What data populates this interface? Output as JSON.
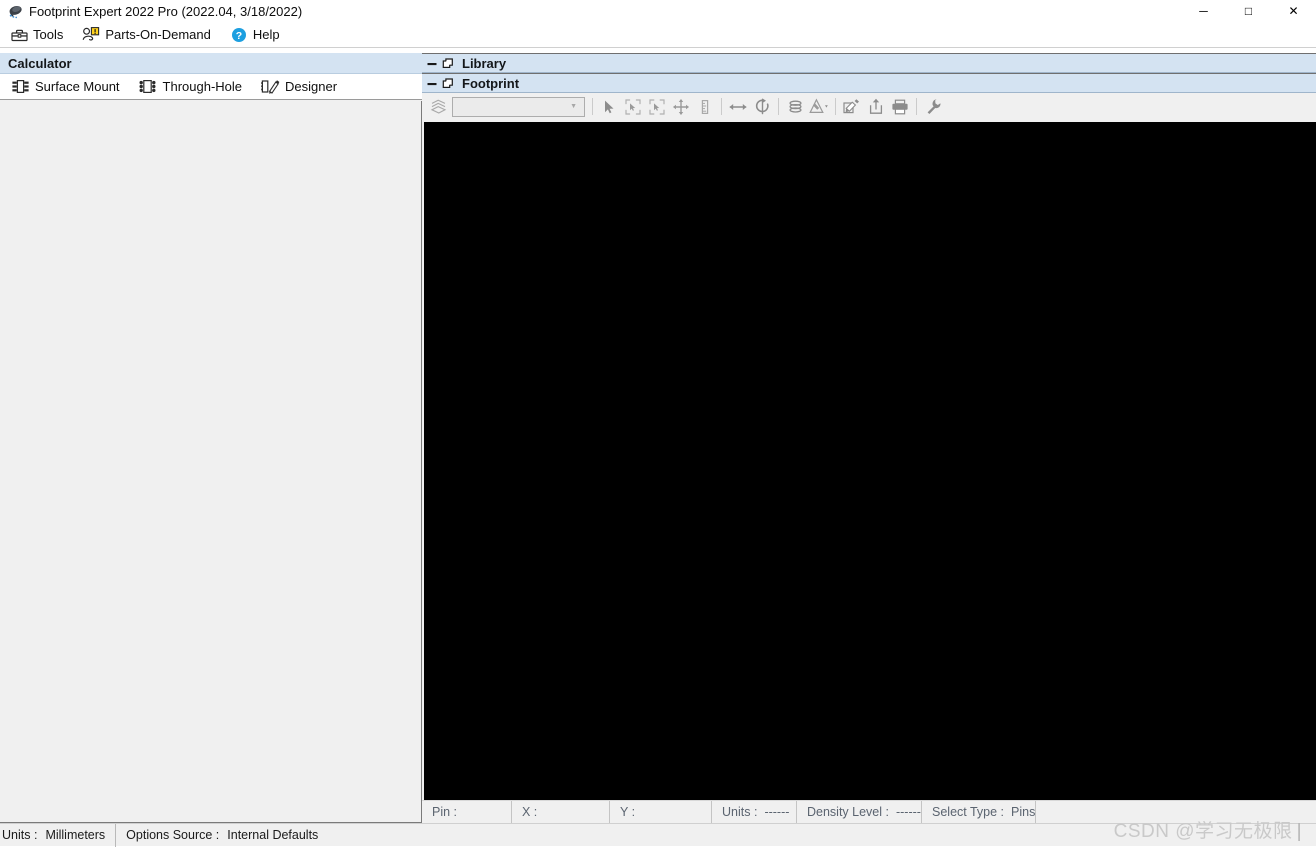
{
  "window": {
    "title": "Footprint Expert 2022 Pro (2022.04, 3/18/2022)",
    "app_icon": "footprint-expert-icon",
    "controls": {
      "minimize": "─",
      "maximize": "□",
      "close": "✕"
    }
  },
  "menubar": {
    "items": [
      {
        "label": "Tools",
        "icon": "toolbox-icon"
      },
      {
        "label": "Parts-On-Demand",
        "icon": "parts-on-demand-icon"
      },
      {
        "label": "Help",
        "icon": "help-circle-icon"
      }
    ]
  },
  "calculator_panel": {
    "caption": "Calculator",
    "buttons": [
      {
        "label": "Surface Mount",
        "icon": "surface-mount-icon"
      },
      {
        "label": "Through-Hole",
        "icon": "through-hole-icon"
      },
      {
        "label": "Designer",
        "icon": "designer-pencil-icon"
      }
    ]
  },
  "library_panel": {
    "caption": "Library",
    "collapse_icon": "minimize-icon",
    "restore_icon": "restore-window-icon"
  },
  "footprint_panel": {
    "caption": "Footprint",
    "collapse_icon": "minimize-icon",
    "restore_icon": "restore-window-icon",
    "toolbar": {
      "layers_icon": "layers-stack-icon",
      "combo_value": "",
      "combo_placeholder": "",
      "combo_arrow_icon": "chevron-down-icon",
      "tools": [
        {
          "name": "select-arrow-icon"
        },
        {
          "name": "zoom-fit-icon"
        },
        {
          "name": "zoom-window-icon"
        },
        {
          "name": "pan-move-icon"
        },
        {
          "name": "measure-icon"
        },
        {
          "name": "flip-horizontal-icon"
        },
        {
          "name": "rotate-icon"
        },
        {
          "name": "layers-icon"
        },
        {
          "name": "draw-tool-icon"
        },
        {
          "name": "edit-pad-icon"
        },
        {
          "name": "export-icon"
        },
        {
          "name": "print-icon"
        },
        {
          "name": "wrench-settings-icon"
        }
      ]
    },
    "status": [
      {
        "label": "Pin :",
        "value": ""
      },
      {
        "label": "X :",
        "value": ""
      },
      {
        "label": "Y :",
        "value": ""
      },
      {
        "label": "Units :",
        "value": "------"
      },
      {
        "label": "Density Level :",
        "value": "------"
      },
      {
        "label": "Select Type :",
        "value": "Pins"
      }
    ]
  },
  "app_status": [
    {
      "label": "Units :",
      "value": "Millimeters"
    },
    {
      "label": "Options Source :",
      "value": "Internal Defaults"
    }
  ],
  "watermark": {
    "text": "CSDN @学习无极限",
    "bar": "|"
  },
  "colors": {
    "caption_bg": "#d4e3f2",
    "panel_bg": "#f0f0f0",
    "canvas_bg": "#000000",
    "status_text": "#5b6470",
    "accent_help": "#1c9fe0",
    "accent_badge": "#ffd21e"
  }
}
